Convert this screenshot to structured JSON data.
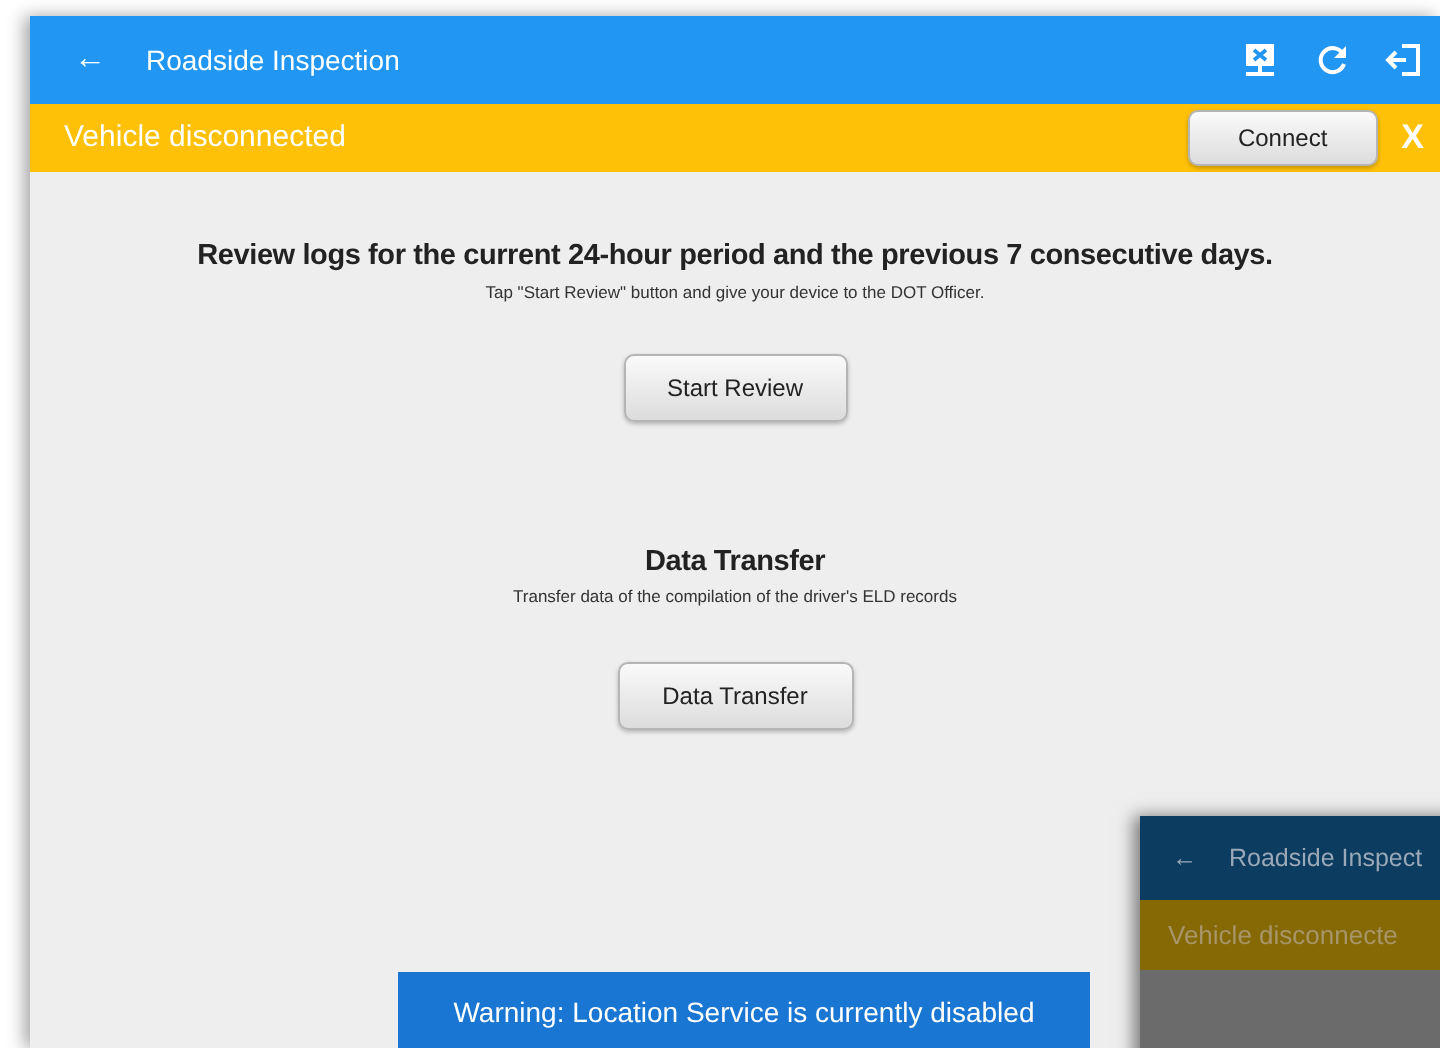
{
  "app_bar": {
    "back": "←",
    "title": "Roadside Inspection"
  },
  "banner": {
    "text": "Vehicle disconnected",
    "button": "Connect",
    "close": "X"
  },
  "review": {
    "heading": "Review logs for the current 24-hour period and the previous 7 consecutive days.",
    "subtext": "Tap \"Start Review\" button and give your device to the DOT Officer.",
    "button": "Start Review"
  },
  "transfer": {
    "heading": "Data Transfer",
    "subtext": "Transfer data of the compilation of the driver's ELD records",
    "button": "Data Transfer"
  },
  "toast": {
    "text": "Warning: Location Service is currently disabled"
  },
  "inset_screenshot": {
    "back": "←",
    "title": "Roadside Inspect",
    "banner": "Vehicle disconnecte"
  }
}
